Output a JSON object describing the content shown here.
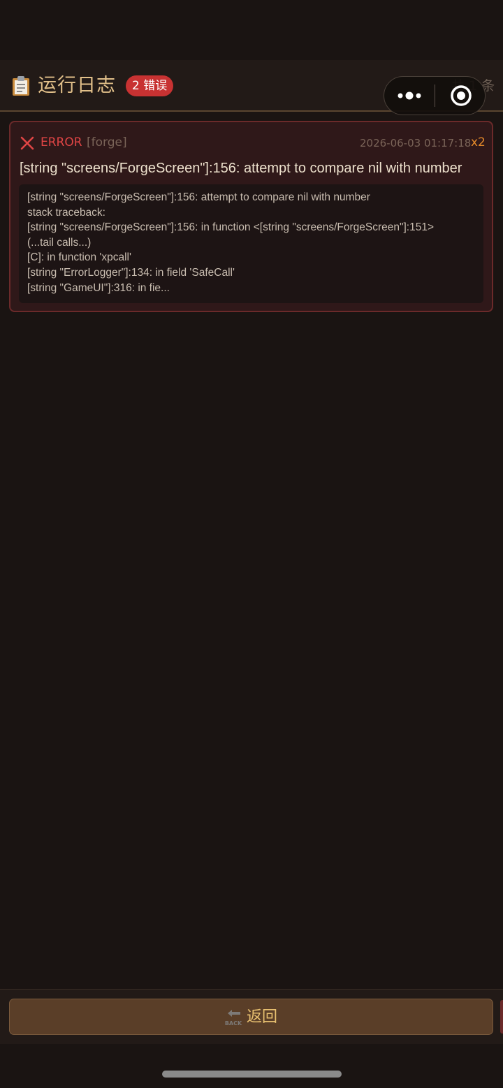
{
  "header": {
    "title": "运行日志",
    "error_badge": "2 错误",
    "count_text": "共 1 条"
  },
  "log_entries": [
    {
      "level": "ERROR",
      "module": "[forge]",
      "timestamp": "2026-06-03 01:17:18",
      "repeat": "x2",
      "message": "[string \"screens/ForgeScreen\"]:156: attempt to compare nil with number",
      "traceback": [
        "[string \"screens/ForgeScreen\"]:156: attempt to compare nil with number",
        "stack traceback:",
        "[string \"screens/ForgeScreen\"]:156: in function <[string \"screens/ForgeScreen\"]:151>",
        "(...tail calls...)",
        "[C]: in function 'xpcall'",
        "[string \"ErrorLogger\"]:134: in field 'SafeCall'",
        "[string \"GameUI\"]:316: in fie..."
      ]
    }
  ],
  "footer": {
    "back_label": "返回",
    "back_icon_text": "BACK"
  },
  "icons": {
    "header": "clipboard-icon",
    "level": "cross-icon",
    "more": "more-dots-icon",
    "close": "target-close-icon",
    "back": "back-arrow-icon"
  },
  "colors": {
    "background": "#1a1412",
    "header_bg": "#221a17",
    "title": "#e2c08a",
    "error": "#e04545",
    "badge": "#c83232",
    "repeat": "#e2882a",
    "card_bg": "#2f1819",
    "card_border": "#6b2a2a",
    "button_bg": "#5a3e28",
    "button_text": "#e8c070"
  }
}
